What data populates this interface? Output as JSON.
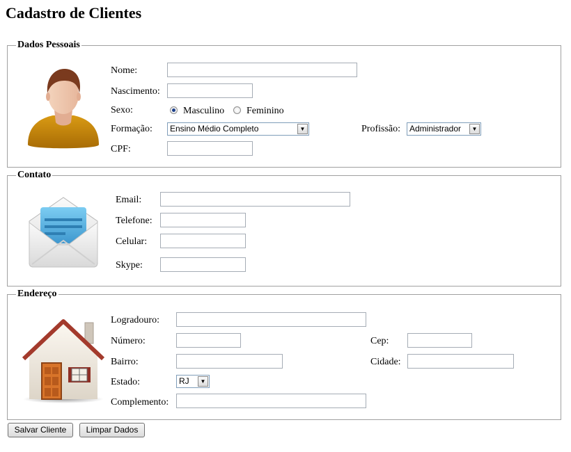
{
  "page": {
    "title": "Cadastro de Clientes"
  },
  "dados_pessoais": {
    "legend": "Dados Pessoais",
    "nome_label": "Nome:",
    "nome_value": "",
    "nascimento_label": "Nascimento:",
    "nascimento_value": "",
    "sexo_label": "Sexo:",
    "sexo_options": [
      "Masculino",
      "Feminino"
    ],
    "sexo_selected": "Masculino",
    "formacao_label": "Formação:",
    "formacao_value": "Ensino Médio Completo",
    "profissao_label": "Profissão:",
    "profissao_value": "Administrador",
    "cpf_label": "CPF:",
    "cpf_value": "",
    "icon": "user-avatar-icon"
  },
  "contato": {
    "legend": "Contato",
    "email_label": "Email:",
    "email_value": "",
    "telefone_label": "Telefone:",
    "telefone_value": "",
    "celular_label": "Celular:",
    "celular_value": "",
    "skype_label": "Skype:",
    "skype_value": "",
    "icon": "envelope-icon"
  },
  "endereco": {
    "legend": "Endereço",
    "logradouro_label": "Logradouro:",
    "logradouro_value": "",
    "numero_label": "Número:",
    "numero_value": "",
    "cep_label": "Cep:",
    "cep_value": "",
    "bairro_label": "Bairro:",
    "bairro_value": "",
    "cidade_label": "Cidade:",
    "cidade_value": "",
    "estado_label": "Estado:",
    "estado_value": "RJ",
    "complemento_label": "Complemento:",
    "complemento_value": "",
    "icon": "house-icon"
  },
  "actions": {
    "save_label": "Salvar Cliente",
    "clear_label": "Limpar Dados"
  },
  "colors": {
    "border": "#a0a0a0",
    "radio_dot": "#1b3f8a",
    "shirt": "#c8860a",
    "envelope_blue": "#4aa8dc",
    "roof": "#a33a2c",
    "door": "#d8742a"
  }
}
